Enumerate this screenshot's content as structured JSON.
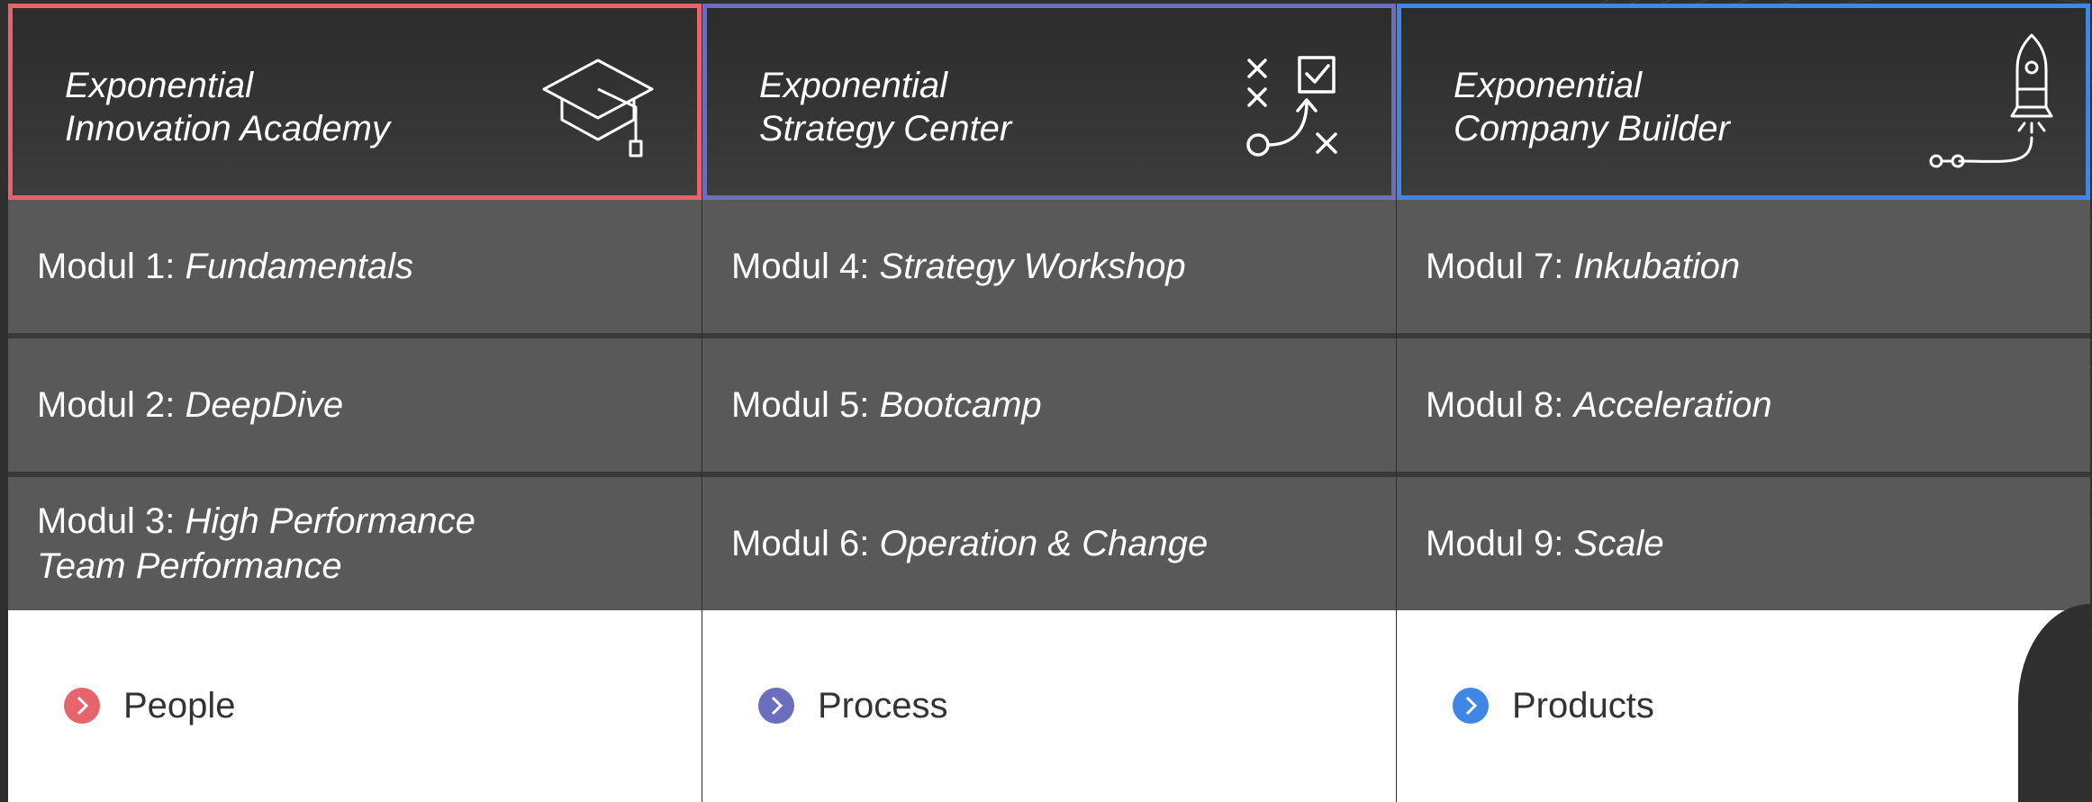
{
  "colors": {
    "people": "#e8646c",
    "process": "#6a6ebc",
    "products": "#3f86e6"
  },
  "columns": [
    {
      "title": "Exponential\nInnovation Academy",
      "icon": "graduation-cap-icon",
      "modules": [
        {
          "prefix": "Modul 1: ",
          "name": "Fundamentals"
        },
        {
          "prefix": "Modul 2: ",
          "name": "DeepDive"
        },
        {
          "prefix": "Modul 3: ",
          "name": "High Performance\nTeam Performance"
        }
      ],
      "footer": "People"
    },
    {
      "title": "Exponential\nStrategy Center",
      "icon": "strategy-play-icon",
      "modules": [
        {
          "prefix": "Modul 4: ",
          "name": "Strategy Workshop"
        },
        {
          "prefix": "Modul 5: ",
          "name": "Bootcamp"
        },
        {
          "prefix": "Modul 6: ",
          "name": "Operation & Change"
        }
      ],
      "footer": "Process"
    },
    {
      "title": "Exponential\nCompany Builder",
      "icon": "rocket-icon",
      "modules": [
        {
          "prefix": "Modul 7: ",
          "name": "Inkubation"
        },
        {
          "prefix": "Modul 8: ",
          "name": "Acceleration"
        },
        {
          "prefix": "Modul 9: ",
          "name": "Scale"
        }
      ],
      "footer": "Products"
    }
  ]
}
